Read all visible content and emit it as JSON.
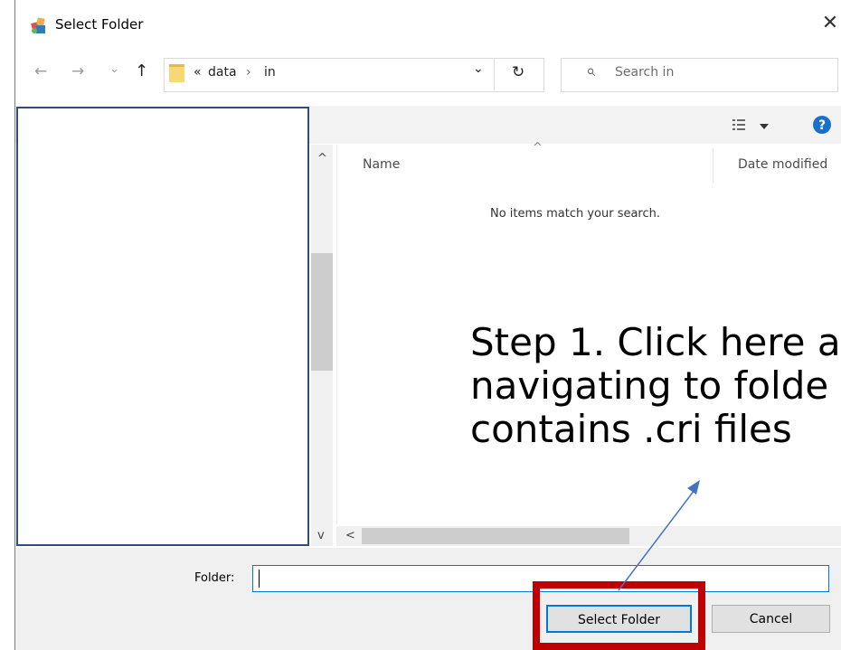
{
  "window": {
    "title": "Select Folder",
    "close_icon": "close-icon"
  },
  "nav": {
    "back_icon": "←",
    "forward_icon": "→",
    "recent_icon": "⌄",
    "up_icon": "↑"
  },
  "address": {
    "overflow": "«",
    "crumbs": [
      "data",
      "in"
    ],
    "separator": "›",
    "dropdown_icon": "⌄",
    "refresh_icon": "↻"
  },
  "search": {
    "placeholder": "Search in",
    "icon": "⌕"
  },
  "file_list": {
    "columns": [
      "Name",
      "Date modified"
    ],
    "sort_indicator": "^",
    "empty_message": "No items match your search."
  },
  "scroll": {
    "up": "^",
    "down": "v",
    "left": "<",
    "right": ">"
  },
  "footer": {
    "folder_label": "Folder:",
    "folder_value": "",
    "select_button": "Select Folder",
    "cancel_button": "Cancel"
  },
  "annotation": {
    "lines": [
      "Step 1. Click here a",
      "navigating to folde",
      "contains .cri files"
    ]
  },
  "colors": {
    "accent": "#0078d7",
    "highlight_box": "#c00000",
    "nav_pane_border": "#2f4e79",
    "arrow": "#4472c4"
  }
}
